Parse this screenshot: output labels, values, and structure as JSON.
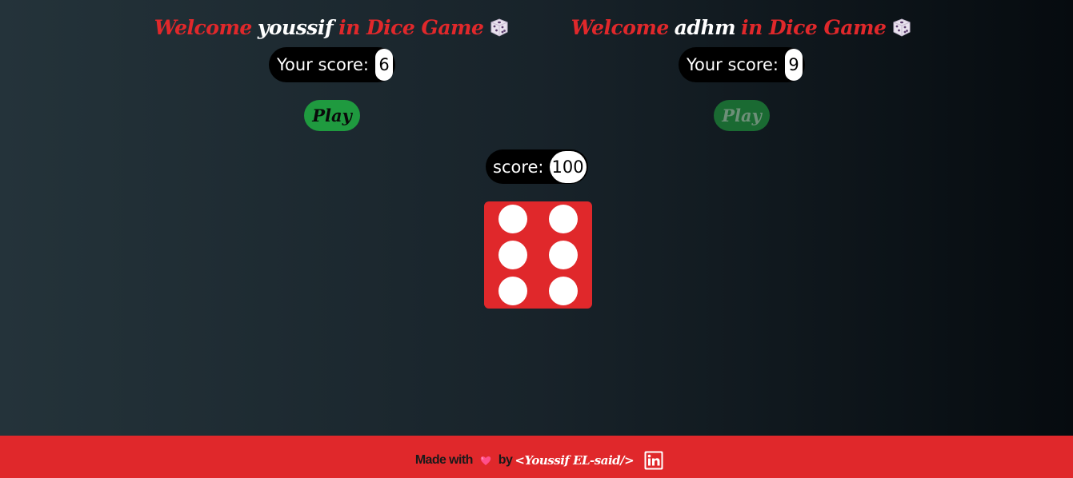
{
  "players": [
    {
      "welcome_prefix": "Welcome",
      "name": "youssif",
      "welcome_suffix": "in Dice Game",
      "score_label": "Your score:",
      "score": "6",
      "play_label": "Play",
      "play_enabled": true
    },
    {
      "welcome_prefix": "Welcome",
      "name": "adhm",
      "welcome_suffix": "in Dice Game",
      "score_label": "Your score:",
      "score": "9",
      "play_label": "Play",
      "play_enabled": false
    }
  ],
  "target": {
    "label": "score:",
    "value": "100"
  },
  "die": {
    "face": 6,
    "color": "#e0282b"
  },
  "footer": {
    "made_with": "Made with",
    "heart_icon": "heart-icon",
    "by": "by",
    "author": "<Youssif EL-said/>",
    "link_icon": "linkedin-icon"
  },
  "colors": {
    "accent": "#e0282b",
    "play_button": "#1f9a3f",
    "play_button_disabled": "#1a6a32"
  }
}
